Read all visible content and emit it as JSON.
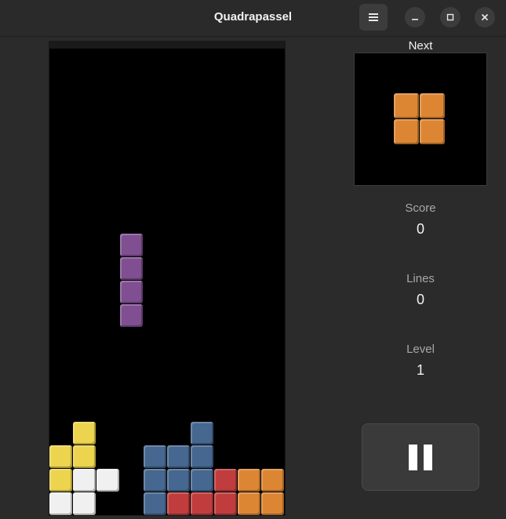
{
  "window": {
    "title": "Quadrapassel"
  },
  "sidebar": {
    "next_label": "Next",
    "score_label": "Score",
    "score_value": "0",
    "lines_label": "Lines",
    "lines_value": "0",
    "level_label": "Level",
    "level_value": "1"
  },
  "icons": {
    "menu": "hamburger-menu-icon",
    "minimize": "minimize-icon",
    "maximize": "maximize-icon",
    "close": "close-icon",
    "pause": "pause-icon"
  },
  "colors": {
    "yellow": "#ecd44f",
    "white": "#f0f0f0",
    "blue": "#46678f",
    "red": "#c13d3d",
    "orange": "#dc8634",
    "purple": "#7f4f91"
  },
  "board": {
    "columns": 10,
    "rows": 20,
    "falling_piece": {
      "color": "purple",
      "cells": [
        [
          3,
          8
        ],
        [
          3,
          9
        ],
        [
          3,
          10
        ],
        [
          3,
          11
        ]
      ]
    },
    "locked_cells": [
      {
        "col": 1,
        "row": 16,
        "color": "yellow"
      },
      {
        "col": 6,
        "row": 16,
        "color": "blue"
      },
      {
        "col": 0,
        "row": 17,
        "color": "yellow"
      },
      {
        "col": 1,
        "row": 17,
        "color": "yellow"
      },
      {
        "col": 4,
        "row": 17,
        "color": "blue"
      },
      {
        "col": 5,
        "row": 17,
        "color": "blue"
      },
      {
        "col": 6,
        "row": 17,
        "color": "blue"
      },
      {
        "col": 0,
        "row": 18,
        "color": "yellow"
      },
      {
        "col": 1,
        "row": 18,
        "color": "white"
      },
      {
        "col": 2,
        "row": 18,
        "color": "white"
      },
      {
        "col": 4,
        "row": 18,
        "color": "blue"
      },
      {
        "col": 5,
        "row": 18,
        "color": "blue"
      },
      {
        "col": 6,
        "row": 18,
        "color": "blue"
      },
      {
        "col": 7,
        "row": 18,
        "color": "red"
      },
      {
        "col": 8,
        "row": 18,
        "color": "orange"
      },
      {
        "col": 9,
        "row": 18,
        "color": "orange"
      },
      {
        "col": 0,
        "row": 19,
        "color": "white"
      },
      {
        "col": 1,
        "row": 19,
        "color": "white"
      },
      {
        "col": 4,
        "row": 19,
        "color": "blue"
      },
      {
        "col": 5,
        "row": 19,
        "color": "red"
      },
      {
        "col": 6,
        "row": 19,
        "color": "red"
      },
      {
        "col": 7,
        "row": 19,
        "color": "red"
      },
      {
        "col": 8,
        "row": 19,
        "color": "orange"
      },
      {
        "col": 9,
        "row": 19,
        "color": "orange"
      }
    ]
  },
  "next_piece": {
    "color": "orange",
    "cells": [
      [
        0,
        0
      ],
      [
        1,
        0
      ],
      [
        0,
        1
      ],
      [
        1,
        1
      ]
    ]
  }
}
